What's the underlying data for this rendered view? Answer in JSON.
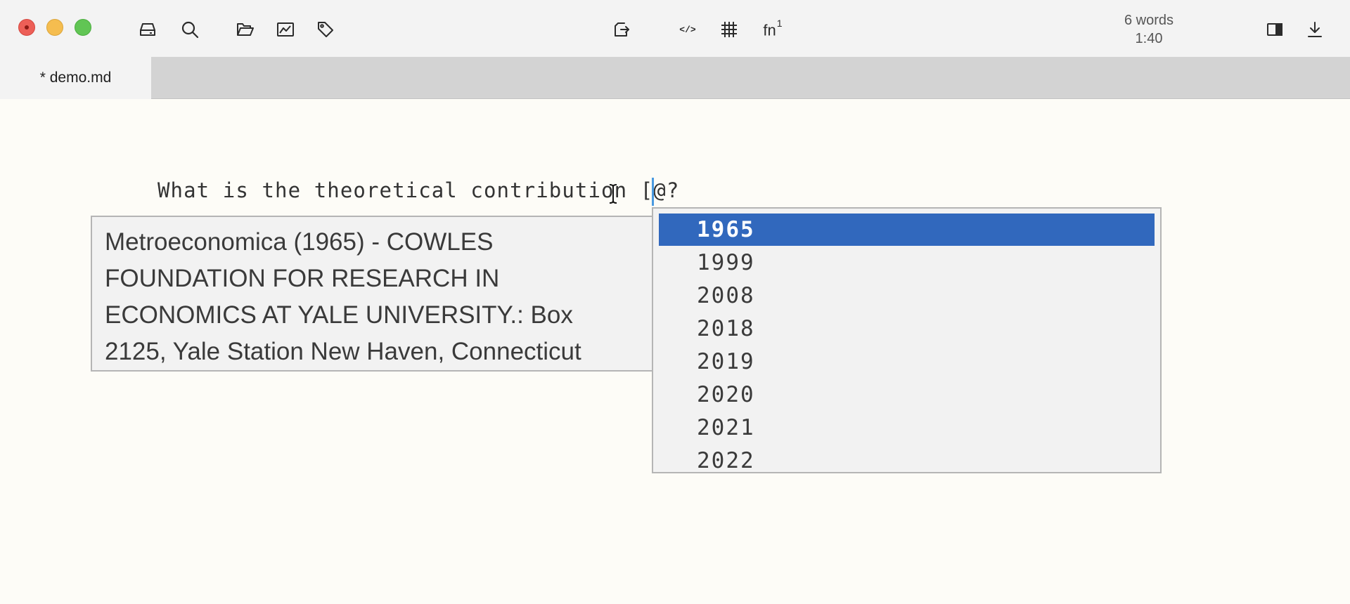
{
  "window": {
    "controls": [
      "close",
      "minimize",
      "maximize"
    ]
  },
  "toolbar": {
    "left_icons": [
      "drive-icon",
      "search-icon",
      "folder-icon",
      "chart-icon",
      "tag-icon"
    ],
    "center_icons": [
      "export-icon",
      "code-icon",
      "table-icon",
      "footnote-icon"
    ],
    "code_label": "</>",
    "footnote_label": "fn",
    "footnote_sup": "1",
    "right_icons": [
      "sidebar-toggle-icon",
      "download-icon"
    ]
  },
  "stats": {
    "words": "6 words",
    "time": "1:40"
  },
  "tabs": [
    {
      "label": "* demo.md",
      "active": true
    }
  ],
  "editor": {
    "text": "What is the theoretical contribution [@?"
  },
  "info_popup": {
    "text": "Metroeconomica (1965) - COWLES FOUNDATION FOR RESEARCH IN ECONOMICS AT YALE UNIVERSITY.: Box 2125, Yale Station New Haven, Connecticut"
  },
  "autocomplete": {
    "selected_index": 0,
    "items": [
      "1965",
      "1999",
      "2008",
      "2018",
      "2019",
      "2020",
      "2021",
      "2022"
    ]
  },
  "colors": {
    "selection": "#3168bd",
    "caret": "#4a9ae0",
    "editor_bg": "#fdfcf7",
    "toolbar_bg": "#f3f3f3",
    "tabbar_bg": "#d3d3d3"
  }
}
